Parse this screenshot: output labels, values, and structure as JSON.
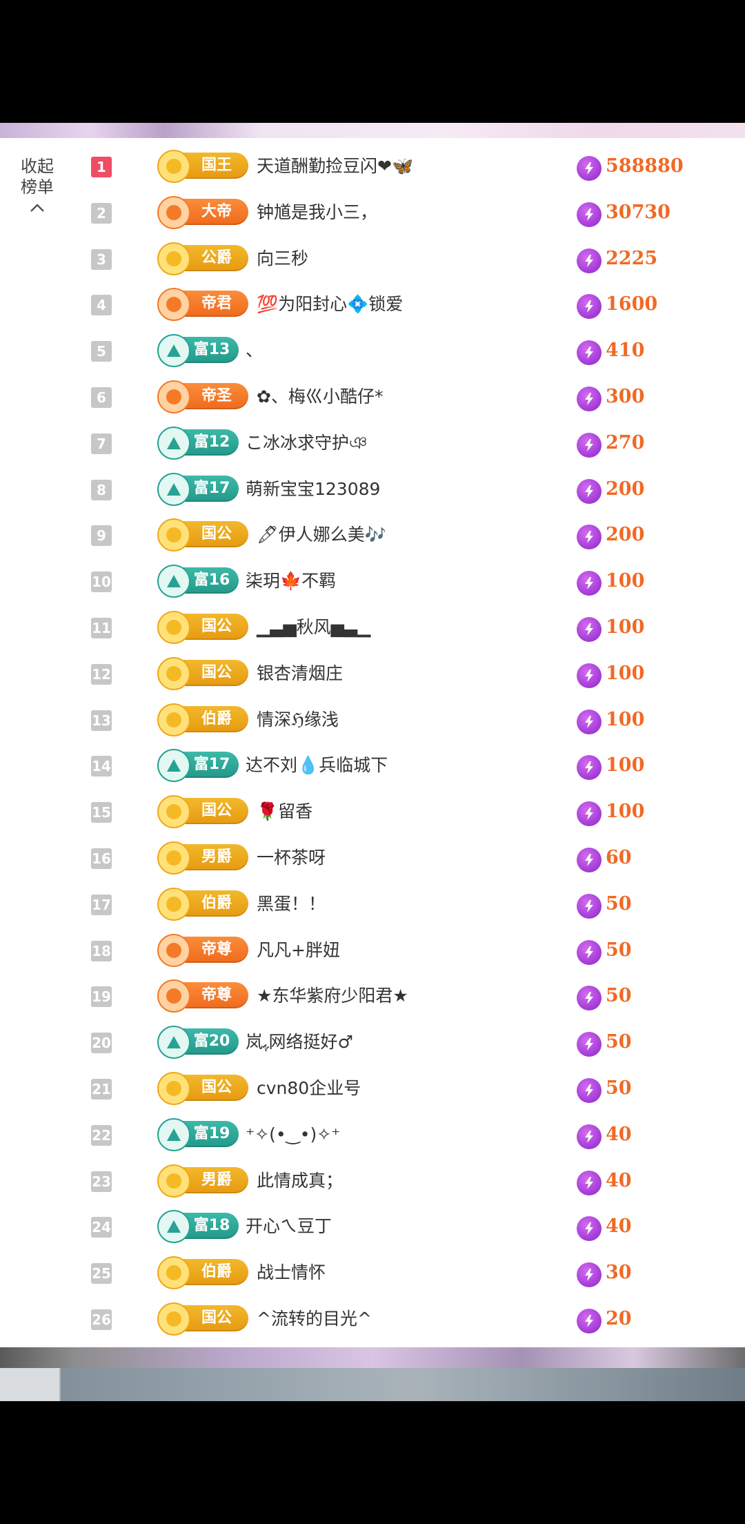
{
  "collapse": {
    "line1": "收起",
    "line2": "榜单"
  },
  "rows": [
    {
      "rank": "1",
      "badge": "国王",
      "style": "gold",
      "name": "天道酬勤捡豆闪❤🦋",
      "score": "588880"
    },
    {
      "rank": "2",
      "badge": "大帝",
      "style": "orange",
      "name": "钟馗是我小三，",
      "score": "30730"
    },
    {
      "rank": "3",
      "badge": "公爵",
      "style": "gold",
      "name": "向三秒",
      "score": "2225"
    },
    {
      "rank": "4",
      "badge": "帝君",
      "style": "orange",
      "name": "💯为阳封心💠锁爱",
      "score": "1600"
    },
    {
      "rank": "5",
      "badge": "富13",
      "style": "teal",
      "name": "、",
      "score": "410"
    },
    {
      "rank": "6",
      "badge": "帝圣",
      "style": "orange",
      "name": "✿、梅巛小酷仔*",
      "score": "300"
    },
    {
      "rank": "7",
      "badge": "富12",
      "style": "teal",
      "name": "こ冰冰求守护ঞ",
      "score": "270"
    },
    {
      "rank": "8",
      "badge": "富17",
      "style": "teal",
      "name": "萌新宝宝123089",
      "score": "200"
    },
    {
      "rank": "9",
      "badge": "国公",
      "style": "gold",
      "name": "🖋伊人娜么美🎶",
      "score": "200"
    },
    {
      "rank": "10",
      "badge": "富16",
      "style": "teal",
      "name": "柒玥🍁不羁",
      "score": "100"
    },
    {
      "rank": "11",
      "badge": "国公",
      "style": "gold",
      "name": "▁▃▅秋风▅▃▁",
      "score": "100"
    },
    {
      "rank": "12",
      "badge": "国公",
      "style": "gold",
      "name": "银杏清烟庄",
      "score": "100"
    },
    {
      "rank": "13",
      "badge": "伯爵",
      "style": "gold",
      "name": "情深ℌ缘浅",
      "score": "100"
    },
    {
      "rank": "14",
      "badge": "富17",
      "style": "teal",
      "name": "达不刘💧兵临城下",
      "score": "100"
    },
    {
      "rank": "15",
      "badge": "国公",
      "style": "gold",
      "name": "🌹留香",
      "score": "100"
    },
    {
      "rank": "16",
      "badge": "男爵",
      "style": "gold",
      "name": "一杯茶呀",
      "score": "60"
    },
    {
      "rank": "17",
      "badge": "伯爵",
      "style": "gold",
      "name": "黑蛋！！",
      "score": "50"
    },
    {
      "rank": "18",
      "badge": "帝尊",
      "style": "orange",
      "name": "凡凡+胖妞",
      "score": "50"
    },
    {
      "rank": "19",
      "badge": "帝尊",
      "style": "orange",
      "name": "★东华紫府少阳君★",
      "score": "50"
    },
    {
      "rank": "20",
      "badge": "富20",
      "style": "teal",
      "name": "岚ﮩ网络挺好♂",
      "score": "50"
    },
    {
      "rank": "21",
      "badge": "国公",
      "style": "gold",
      "name": "cvn80企业号",
      "score": "50"
    },
    {
      "rank": "22",
      "badge": "富19",
      "style": "teal",
      "name": "⁺✧(•‿•)✧⁺",
      "score": "40"
    },
    {
      "rank": "23",
      "badge": "男爵",
      "style": "gold",
      "name": "此情成真；",
      "score": "40"
    },
    {
      "rank": "24",
      "badge": "富18",
      "style": "teal",
      "name": "开心ㄟ豆丁",
      "score": "40"
    },
    {
      "rank": "25",
      "badge": "伯爵",
      "style": "gold",
      "name": "战士情怀",
      "score": "30"
    },
    {
      "rank": "26",
      "badge": "国公",
      "style": "gold",
      "name": "^流转的目光^",
      "score": "20"
    }
  ],
  "icons": {
    "collapse": "chevron-up-icon",
    "gift": "lightning-gift-icon"
  },
  "colors": {
    "score": "#f06a25",
    "gold": "#f0a818",
    "orange": "#f57a28",
    "teal": "#27a293",
    "rank1": "#ee4d64"
  }
}
